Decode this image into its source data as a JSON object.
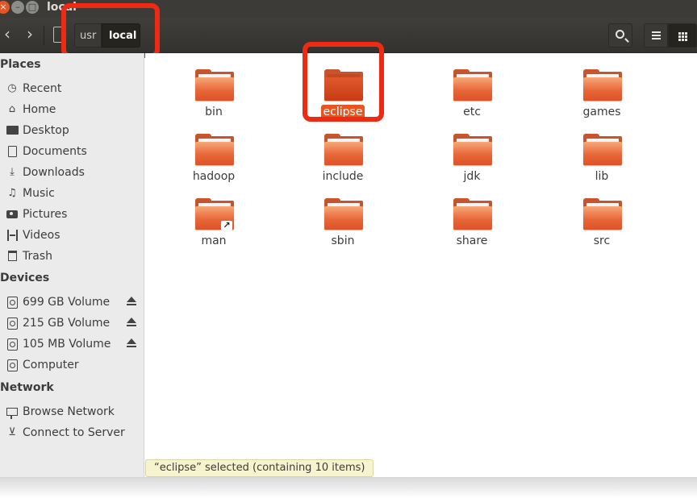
{
  "window": {
    "title": "local",
    "close_glyph": "×",
    "min_glyph": "–",
    "max_glyph": "□"
  },
  "toolbar": {
    "back_glyph": "‹",
    "forward_glyph": "›",
    "breadcrumb": [
      "usr",
      "local"
    ],
    "icons": [
      "search-icon",
      "list-view-icon",
      "grid-view-icon"
    ]
  },
  "sidebar": {
    "places_heading": "Places",
    "places": [
      {
        "label": "Recent",
        "icon": "clock-icon",
        "glyph": "◷"
      },
      {
        "label": "Home",
        "icon": "home-icon",
        "glyph": "⌂"
      },
      {
        "label": "Desktop",
        "icon": "folder-icon"
      },
      {
        "label": "Documents",
        "icon": "document-icon"
      },
      {
        "label": "Downloads",
        "icon": "download-icon",
        "glyph": "⤓"
      },
      {
        "label": "Music",
        "icon": "music-icon",
        "glyph": "♫"
      },
      {
        "label": "Pictures",
        "icon": "camera-icon"
      },
      {
        "label": "Videos",
        "icon": "film-icon"
      },
      {
        "label": "Trash",
        "icon": "trash-icon"
      }
    ],
    "devices_heading": "Devices",
    "devices": [
      {
        "label": "699 GB Volume",
        "ejectable": true
      },
      {
        "label": "215 GB Volume",
        "ejectable": true
      },
      {
        "label": "105 MB Volume",
        "ejectable": true
      },
      {
        "label": "Computer",
        "ejectable": false
      }
    ],
    "network_heading": "Network",
    "network": [
      {
        "label": "Browse Network",
        "icon": "network-icon"
      },
      {
        "label": "Connect to Server",
        "icon": "server-icon",
        "glyph": "⊻"
      }
    ]
  },
  "files": [
    {
      "name": "bin",
      "selected": false,
      "symlink": false
    },
    {
      "name": "eclipse",
      "selected": true,
      "symlink": false
    },
    {
      "name": "etc",
      "selected": false,
      "symlink": false
    },
    {
      "name": "games",
      "selected": false,
      "symlink": false
    },
    {
      "name": "hadoop",
      "selected": false,
      "symlink": false
    },
    {
      "name": "include",
      "selected": false,
      "symlink": false
    },
    {
      "name": "jdk",
      "selected": false,
      "symlink": false
    },
    {
      "name": "lib",
      "selected": false,
      "symlink": false
    },
    {
      "name": "man",
      "selected": false,
      "symlink": true
    },
    {
      "name": "sbin",
      "selected": false,
      "symlink": false
    },
    {
      "name": "share",
      "selected": false,
      "symlink": false
    },
    {
      "name": "src",
      "selected": false,
      "symlink": false
    }
  ],
  "symlink_glyph": "↗",
  "status": "“eclipse” selected  (containing 10 items)",
  "colors": {
    "accent": "#e95420",
    "highlight_annotation": "#ee2a12",
    "folder": "#e8673a"
  }
}
